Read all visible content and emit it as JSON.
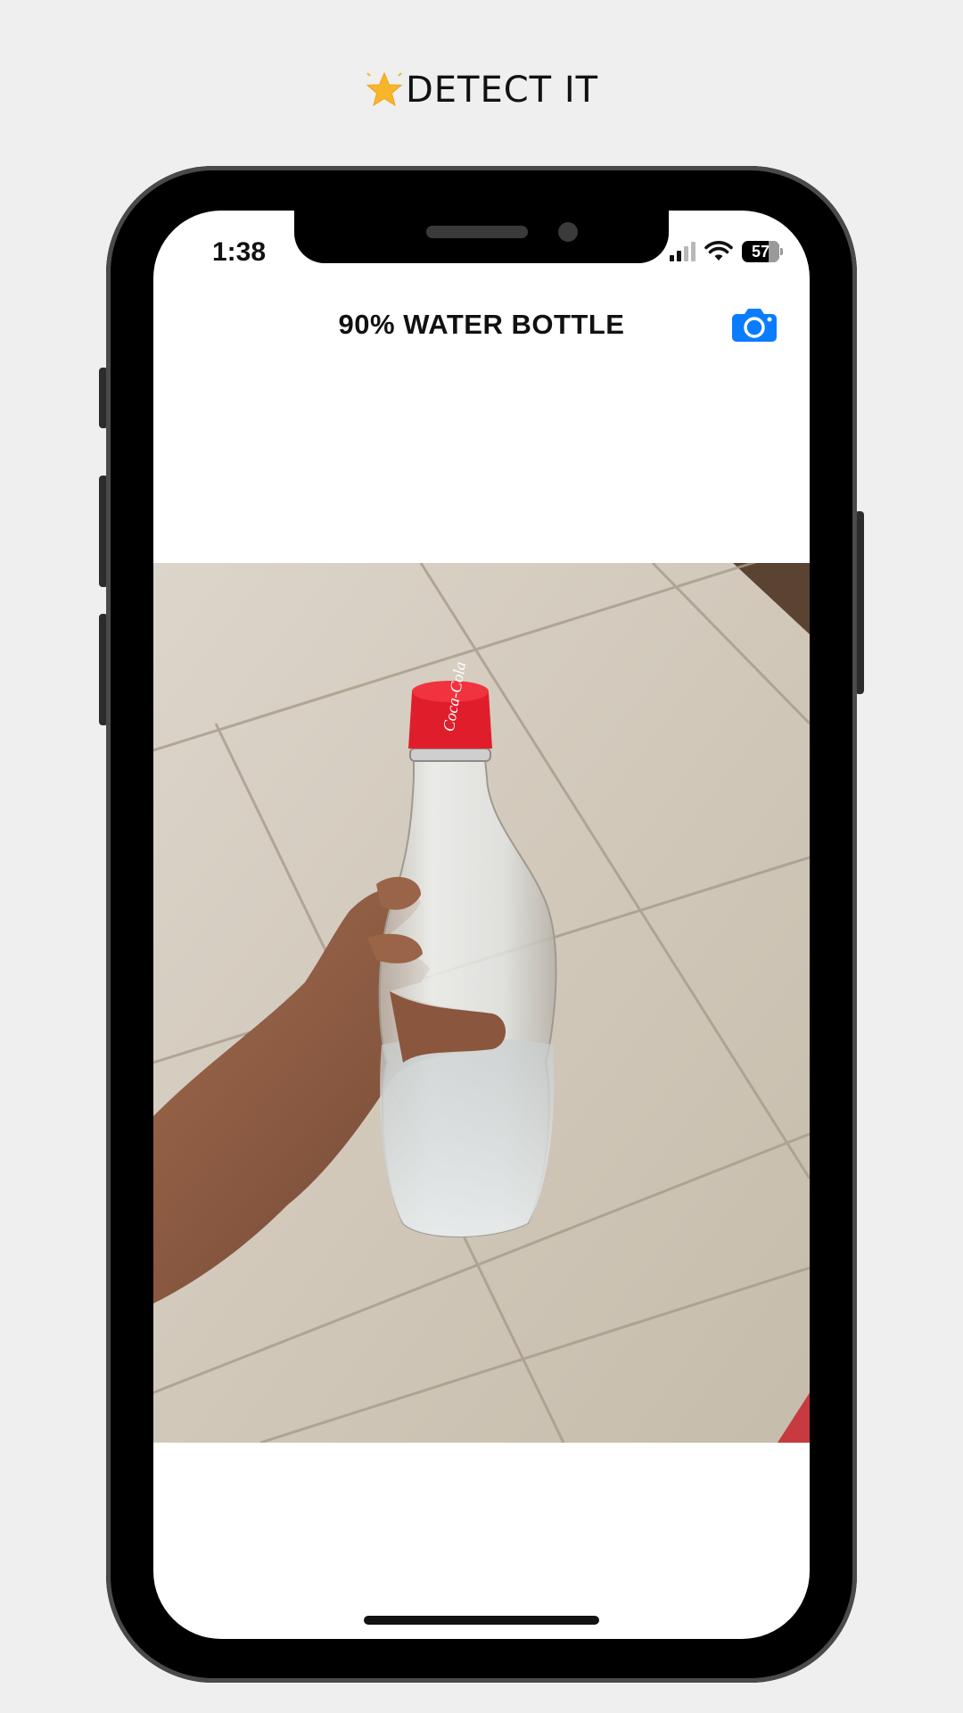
{
  "app": {
    "brand_icon": "star-icon",
    "brand_title": "DETECT IT"
  },
  "status_bar": {
    "time": "1:38",
    "battery": "57",
    "icons": [
      "cellular-signal-icon",
      "wifi-icon",
      "battery-icon"
    ]
  },
  "nav": {
    "title": "90% WATER BOTTLE",
    "camera_icon": "camera-icon"
  },
  "photo": {
    "subject": "hand holding clear plastic bottle with red cap",
    "cap_text": "Coca-Cola"
  },
  "colors": {
    "page_bg": "#efefef",
    "accent_blue": "#0a7cff",
    "cap_red": "#e01e2b",
    "star_yellow": "#f7b52a"
  }
}
